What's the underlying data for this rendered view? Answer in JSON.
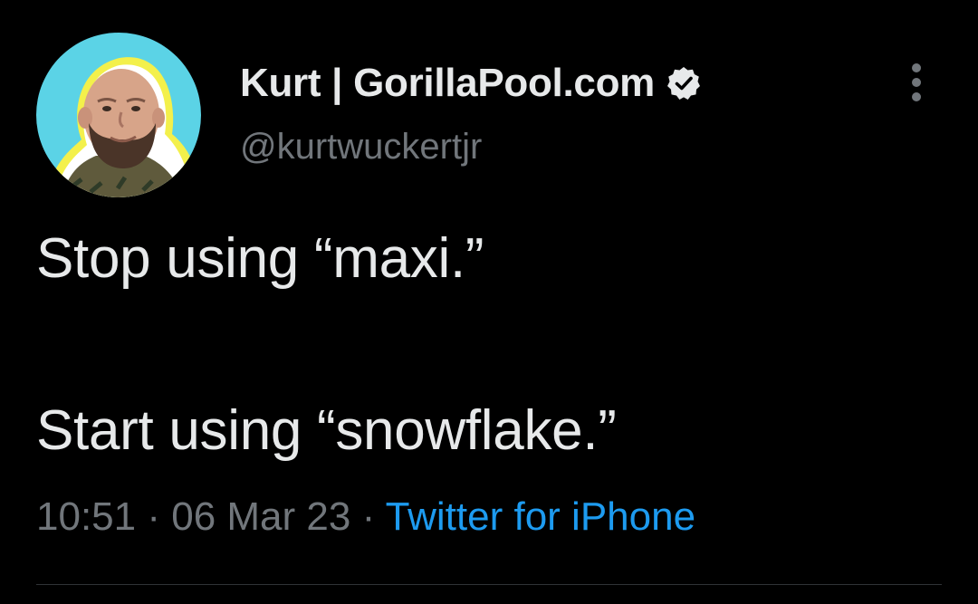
{
  "tweet": {
    "author": {
      "display_name": "Kurt | GorillaPool.com",
      "handle": "@kurtwuckertjr",
      "verified": true
    },
    "text_line_1": "Stop using “maxi.”",
    "text_line_2": "Start using “snowflake.”",
    "time": "10:51",
    "separator": "·",
    "date": "06 Mar 23",
    "source": "Twitter for iPhone"
  },
  "icons": {
    "verified": "verified-badge-icon",
    "more": "more-vertical-icon"
  },
  "colors": {
    "background": "#000000",
    "primary_text": "#e7e9ea",
    "secondary_text": "#71767b",
    "link": "#1d9bf0",
    "avatar_bg": "#5bd3e6",
    "avatar_ring": "#f3f04b"
  }
}
